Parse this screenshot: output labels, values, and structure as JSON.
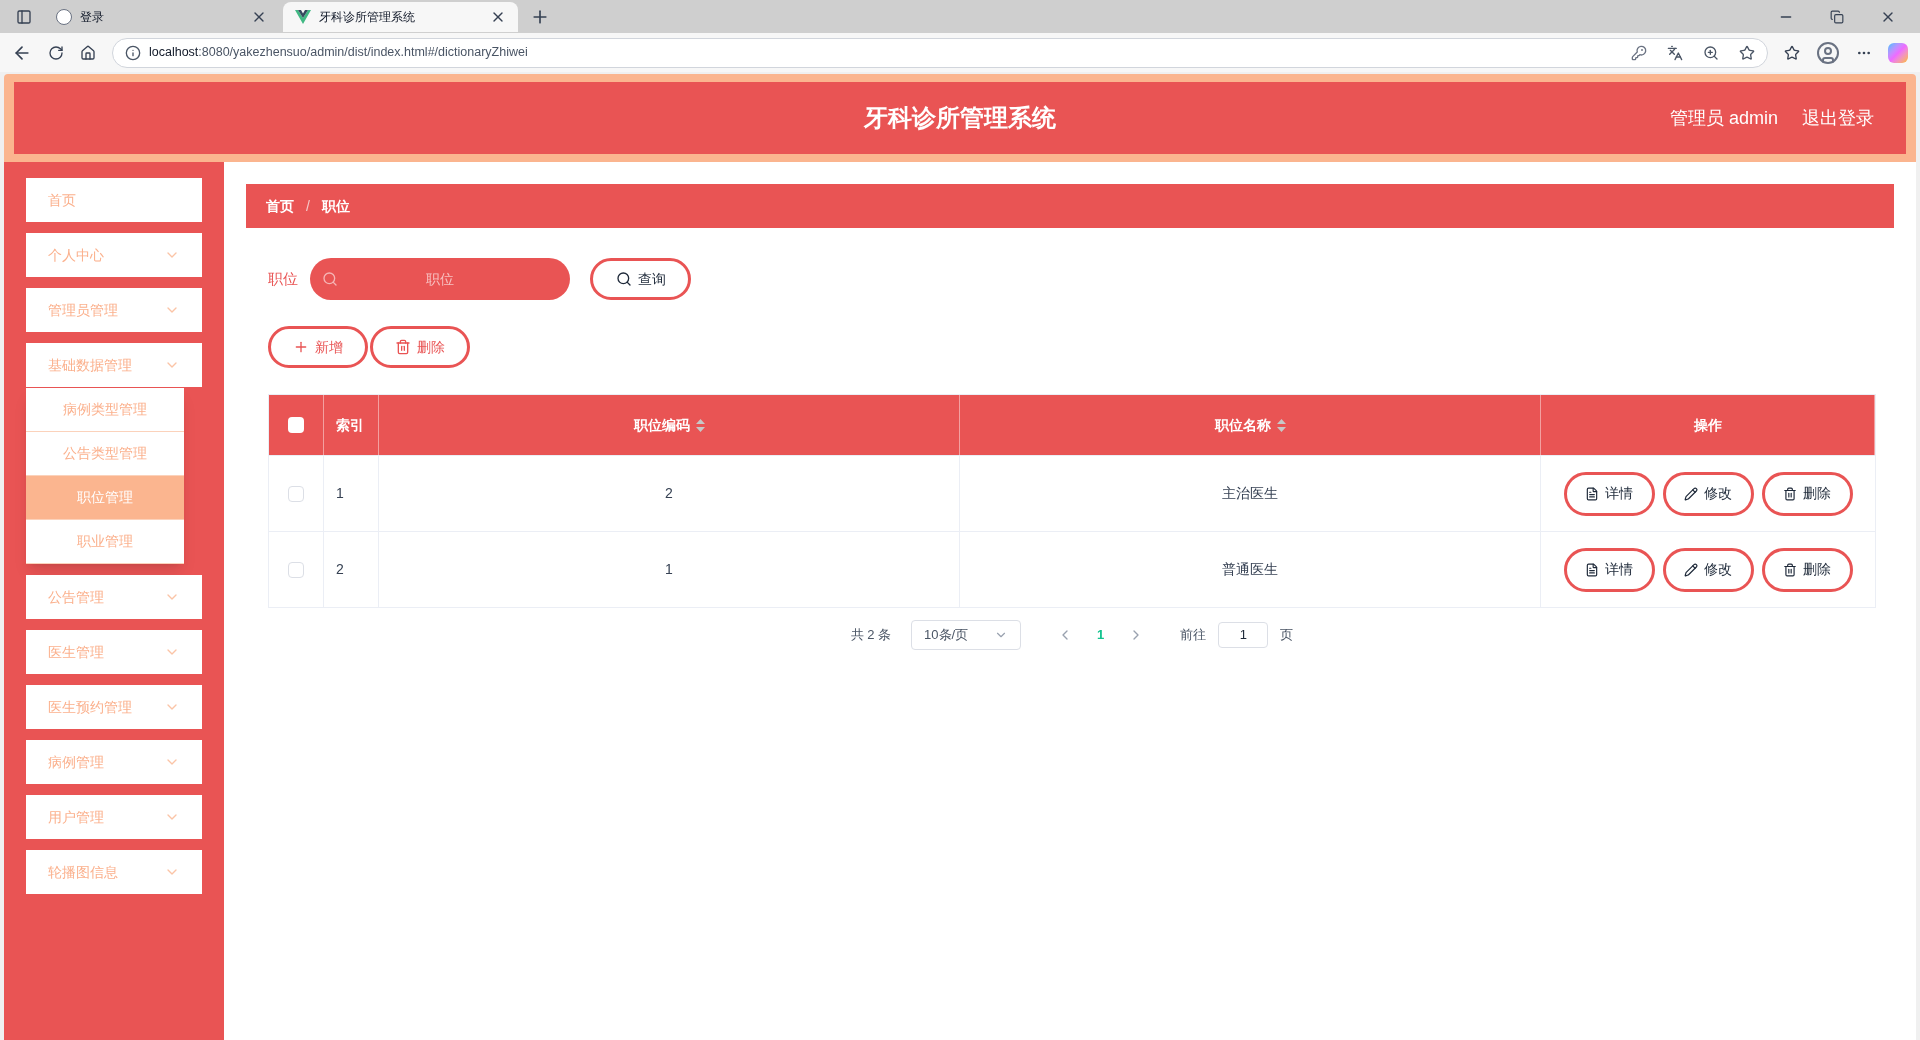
{
  "browser": {
    "tabs": [
      {
        "title": "登录",
        "selected": false
      },
      {
        "title": "牙科诊所管理系统",
        "selected": true
      }
    ],
    "url": {
      "host": "localhost",
      "rest": ":8080/yakezhensuo/admin/dist/index.html#/dictionaryZhiwei"
    }
  },
  "header": {
    "title": "牙科诊所管理系统",
    "user": "管理员 admin",
    "logout": "退出登录"
  },
  "sidebar": {
    "items": [
      {
        "label": "首页",
        "has_children": false
      },
      {
        "label": "个人中心",
        "has_children": true
      },
      {
        "label": "管理员管理",
        "has_children": true
      },
      {
        "label": "基础数据管理",
        "has_children": true,
        "children": [
          {
            "label": "病例类型管理",
            "selected": false
          },
          {
            "label": "公告类型管理",
            "selected": false
          },
          {
            "label": "职位管理",
            "selected": true
          },
          {
            "label": "职业管理",
            "selected": false
          }
        ]
      },
      {
        "label": "公告管理",
        "has_children": true
      },
      {
        "label": "医生管理",
        "has_children": true
      },
      {
        "label": "医生预约管理",
        "has_children": true
      },
      {
        "label": "病例管理",
        "has_children": true
      },
      {
        "label": "用户管理",
        "has_children": true
      },
      {
        "label": "轮播图信息",
        "has_children": true
      }
    ]
  },
  "breadcrumb": {
    "items": [
      "首页",
      "职位"
    ],
    "separator": "/"
  },
  "search": {
    "label": "职位",
    "placeholder": "职位",
    "button": "查询"
  },
  "actions": [
    {
      "label": "新增",
      "kind": "add"
    },
    {
      "label": "删除",
      "kind": "delete"
    }
  ],
  "table": {
    "select_all": {
      "checked": false
    },
    "columns": [
      {
        "label": "索引",
        "sortable": false
      },
      {
        "label": "职位编码",
        "sortable": true
      },
      {
        "label": "职位名称",
        "sortable": true
      },
      {
        "label": "操作",
        "sortable": false
      }
    ],
    "rows": [
      {
        "checked": false,
        "index": "1",
        "code": "2",
        "name": "主治医生",
        "actions": [
          {
            "label": "详情",
            "kind": "detail"
          },
          {
            "label": "修改",
            "kind": "edit"
          },
          {
            "label": "删除",
            "kind": "delete"
          }
        ]
      },
      {
        "checked": false,
        "index": "2",
        "code": "1",
        "name": "普通医生",
        "actions": [
          {
            "label": "详情",
            "kind": "detail"
          },
          {
            "label": "修改",
            "kind": "edit"
          },
          {
            "label": "删除",
            "kind": "delete"
          }
        ]
      }
    ]
  },
  "pagination": {
    "total": "共 2 条",
    "page_size": "10条/页",
    "pages": [
      {
        "label": "1",
        "selected": true
      }
    ],
    "goto_label": "前往",
    "goto_value": "1",
    "page_suffix": "页"
  }
}
